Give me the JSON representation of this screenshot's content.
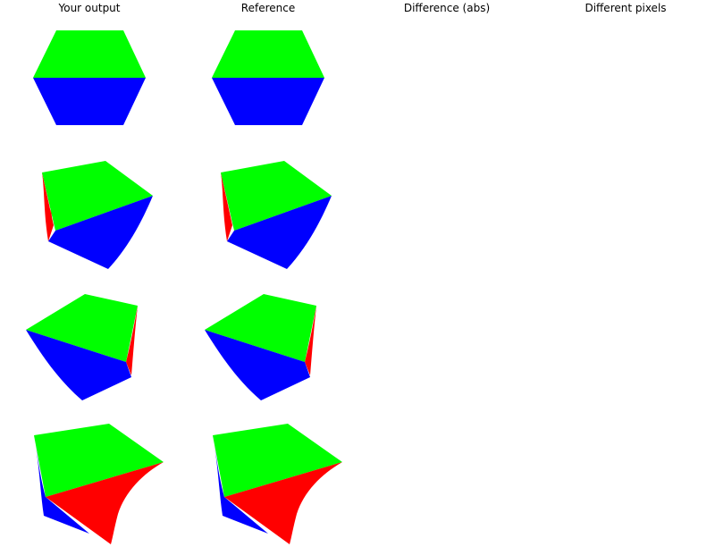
{
  "headers": {
    "output": "Your output",
    "reference": "Reference",
    "difference": "Difference (abs)",
    "different_pixels": "Different pixels"
  },
  "colors": {
    "background": "#ffffff",
    "face_top": "#00ff00",
    "face_front": "#0000ff",
    "face_side": "#ff0000"
  }
}
